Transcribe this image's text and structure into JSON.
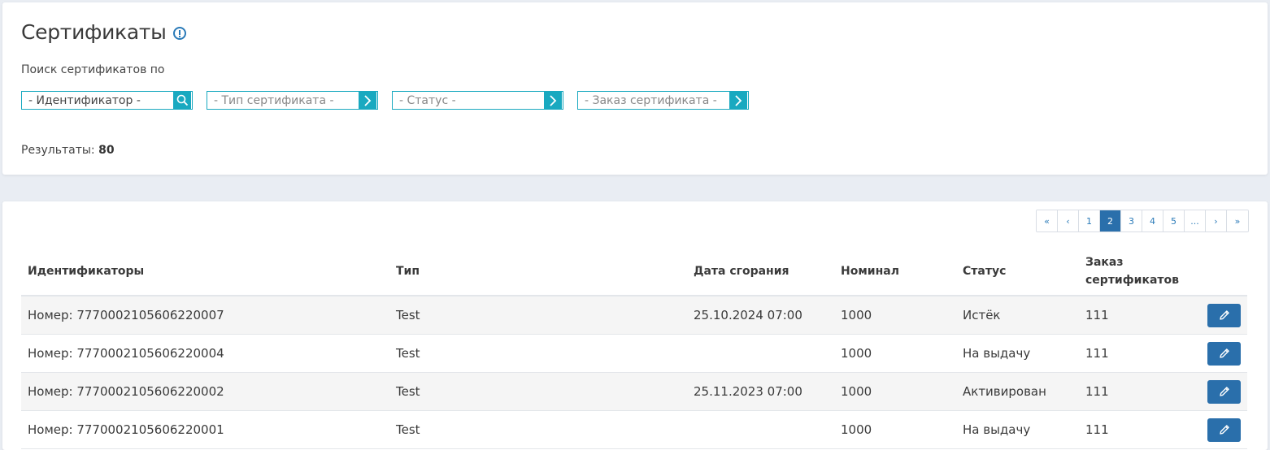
{
  "header": {
    "title": "Сертификаты",
    "search_label": "Поиск сертификатов по",
    "results_label": "Результаты:",
    "results_count": "80"
  },
  "filters": [
    {
      "placeholder": "- Идентификатор -",
      "icon": "search-icon"
    },
    {
      "placeholder": "- Тип сертификата -",
      "icon": "chevron-right-icon"
    },
    {
      "placeholder": "- Статус -",
      "icon": "chevron-right-icon"
    },
    {
      "placeholder": "- Заказ сертификата -",
      "icon": "chevron-right-icon"
    }
  ],
  "pagination": {
    "first": "«",
    "prev": "‹",
    "pages": [
      "1",
      "2",
      "3",
      "4",
      "5",
      "..."
    ],
    "active_page": "2",
    "next": "›",
    "last": "»"
  },
  "table": {
    "headers": {
      "id": "Идентификаторы",
      "type": "Тип",
      "expiry": "Дата сгорания",
      "nominal": "Номинал",
      "status": "Статус",
      "order_1": "Заказ",
      "order_2": "сертификатов"
    },
    "rows": [
      {
        "id": "Номер: 7770002105606220007",
        "type": "Test",
        "expiry": "25.10.2024 07:00",
        "nominal": "1000",
        "status": "Истёк",
        "order": "111"
      },
      {
        "id": "Номер: 7770002105606220004",
        "type": "Test",
        "expiry": "",
        "nominal": "1000",
        "status": "На выдачу",
        "order": "111"
      },
      {
        "id": "Номер: 7770002105606220002",
        "type": "Test",
        "expiry": "25.11.2023 07:00",
        "nominal": "1000",
        "status": "Активирован",
        "order": "111"
      },
      {
        "id": "Номер: 7770002105606220001",
        "type": "Test",
        "expiry": "",
        "nominal": "1000",
        "status": "На выдачу",
        "order": "111"
      }
    ]
  },
  "colors": {
    "accent": "#19a9c0",
    "primary": "#2a6fab"
  }
}
